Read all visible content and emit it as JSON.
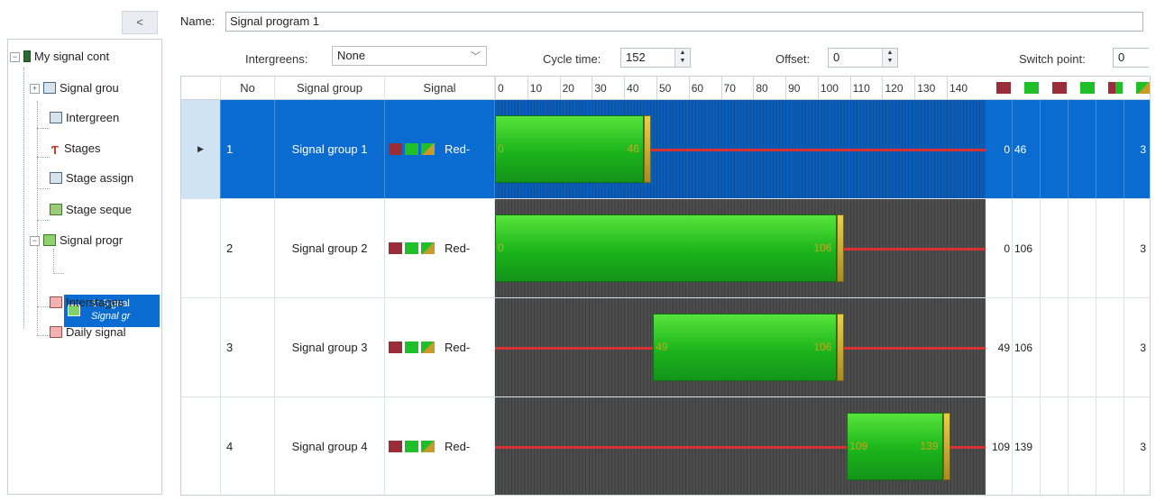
{
  "left_panel": {
    "collapse_label": "<",
    "tree": [
      {
        "label": "My signal cont",
        "icon": "controller-icon"
      },
      {
        "label": "Signal grou",
        "icon": "signal-groups-icon"
      },
      {
        "label": "Intergreen",
        "icon": "intergreen-icon"
      },
      {
        "label": "Stages",
        "icon": "stages-icon"
      },
      {
        "label": "Stage assign",
        "icon": "stage-assign-icon"
      },
      {
        "label": "Stage seque",
        "icon": "stage-sequence-icon"
      },
      {
        "label": "Signal progr",
        "icon": "signal-program-icon"
      },
      {
        "label": "Interstages",
        "icon": "interstages-icon"
      },
      {
        "label": "Daily signal",
        "icon": "daily-signal-icon"
      }
    ],
    "selected_child": {
      "line1": "1: Signal",
      "line2": "Signal gr"
    }
  },
  "name_bar": {
    "label": "Name:",
    "value": "Signal program 1"
  },
  "options": {
    "intergreens_label": "Intergreens:",
    "intergreens_value": "None",
    "cycle_label": "Cycle time:",
    "cycle_value": "152",
    "offset_label": "Offset:",
    "offset_value": "0",
    "switch_label": "Switch point:",
    "switch_value": "0"
  },
  "grid": {
    "headers": {
      "no": "No",
      "group": "Signal group",
      "signal": "Signal"
    },
    "ticks": [
      "0",
      "10",
      "20",
      "30",
      "40",
      "50",
      "60",
      "70",
      "80",
      "90",
      "100",
      "110",
      "120",
      "130",
      "140"
    ],
    "cycle": 152,
    "header_icons": [
      "red",
      "green",
      "red",
      "green",
      "red-amber",
      "amber"
    ],
    "rows": [
      {
        "no": "1",
        "group": "Signal group 1",
        "signal_text": "Red-",
        "green_start": 0,
        "green_end": 46,
        "col_start": "0",
        "col_end": "46",
        "col_last": "3",
        "selected": true
      },
      {
        "no": "2",
        "group": "Signal group 2",
        "signal_text": "Red-",
        "green_start": 0,
        "green_end": 106,
        "col_start": "0",
        "col_end": "106",
        "col_last": "3",
        "selected": false
      },
      {
        "no": "3",
        "group": "Signal group 3",
        "signal_text": "Red-",
        "green_start": 49,
        "green_end": 106,
        "col_start": "49",
        "col_end": "106",
        "col_last": "3",
        "selected": false
      },
      {
        "no": "4",
        "group": "Signal group 4",
        "signal_text": "Red-",
        "green_start": 109,
        "green_end": 139,
        "col_start": "109",
        "col_end": "139",
        "col_last": "3",
        "selected": false
      }
    ]
  },
  "colors": {
    "selection": "#0a6cd1",
    "green": "#1fbf2a",
    "red": "#d83131",
    "amber": "#c8a520"
  }
}
